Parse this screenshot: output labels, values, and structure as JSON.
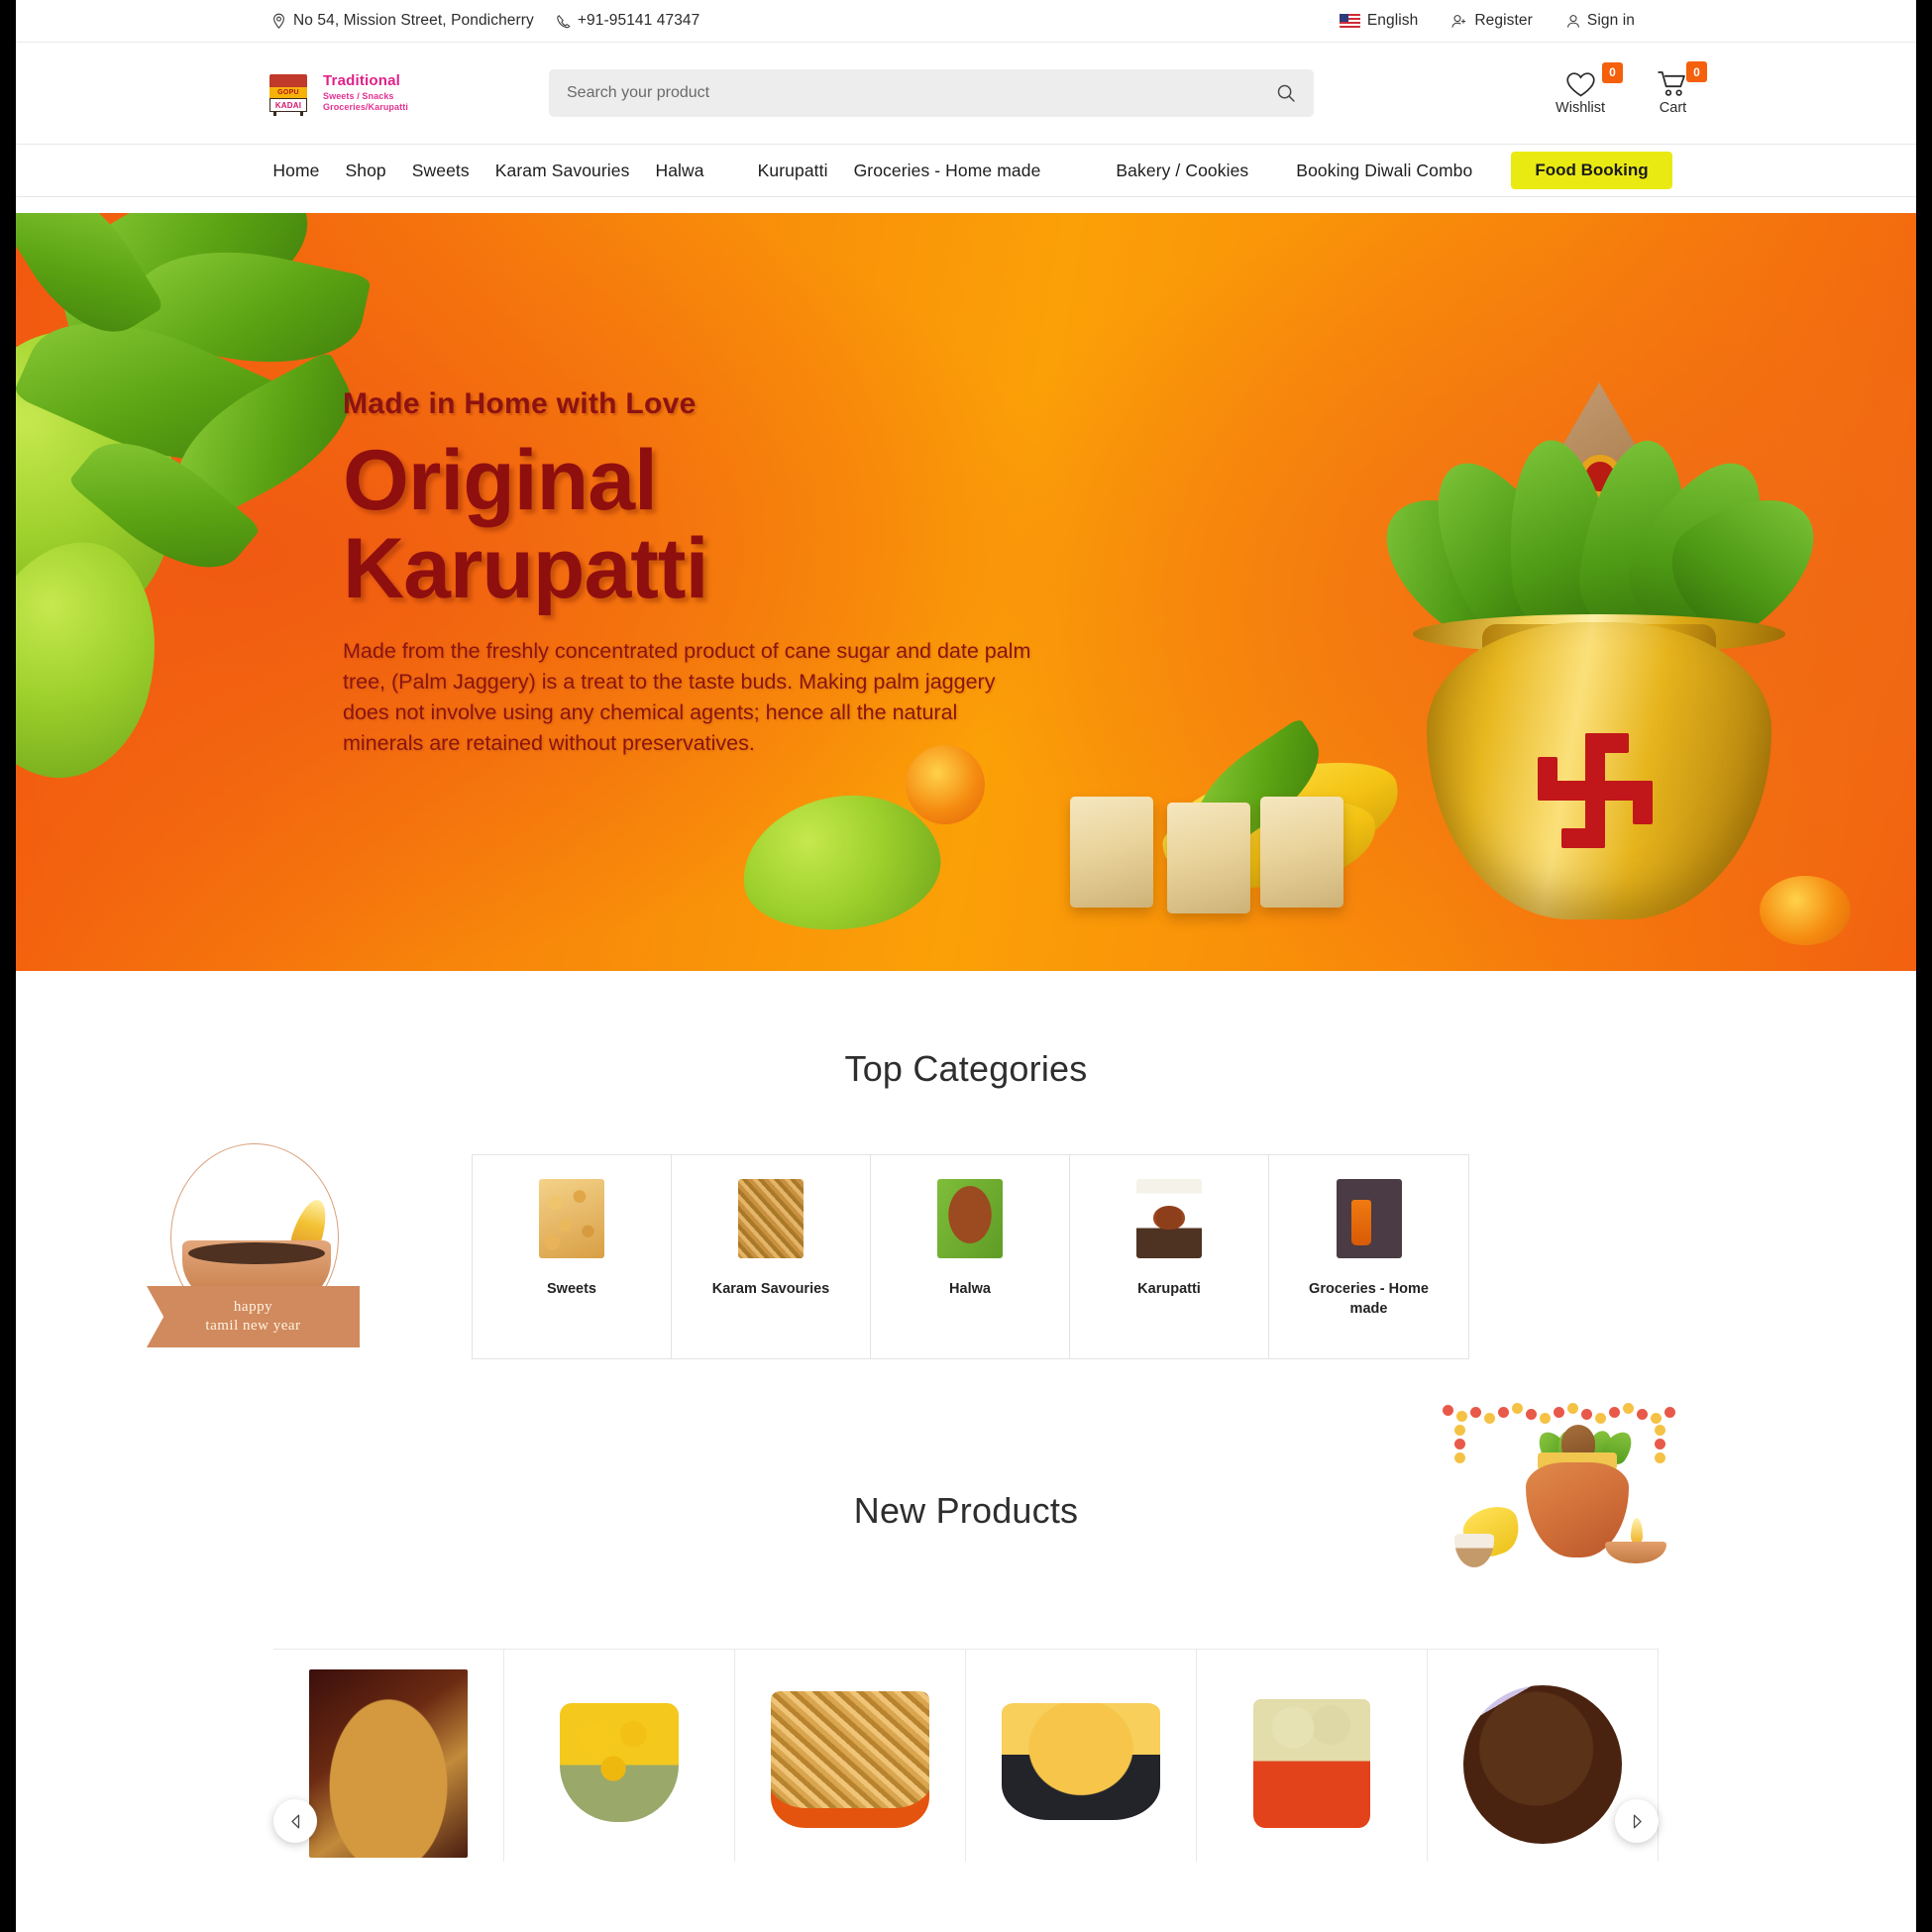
{
  "topbar": {
    "address": "No 54, Mission Street, Pondicherry",
    "phone": "+91-95141 47347",
    "language": "English",
    "register": "Register",
    "signin": "Sign in",
    "icons": {
      "location": "location-pin-icon",
      "phone": "phone-icon",
      "flag": "us-flag-icon",
      "register": "user-add-icon",
      "signin": "user-icon"
    }
  },
  "header": {
    "logo": {
      "shop_sign": "GOPU",
      "shop_name": "KADAI",
      "line1": "Traditional",
      "line2": "Sweets / Snacks",
      "line3": "Groceries/Karupatti"
    },
    "search": {
      "placeholder": "Search your product",
      "value": "",
      "icon": "search-icon"
    },
    "wishlist": {
      "label": "Wishlist",
      "count": "0",
      "icon": "heart-icon"
    },
    "cart": {
      "label": "Cart",
      "count": "0",
      "icon": "shopping-cart-icon"
    },
    "accent_color": "#f4600b"
  },
  "nav": {
    "items": [
      {
        "label": "Home"
      },
      {
        "label": "Shop"
      },
      {
        "label": "Sweets"
      },
      {
        "label": "Karam Savouries"
      },
      {
        "label": "Halwa"
      },
      {
        "label": "Kurupatti"
      },
      {
        "label": "Groceries - Home made"
      },
      {
        "label": "Bakery / Cookies"
      },
      {
        "label": "Booking Diwali Combo"
      }
    ],
    "cta": {
      "label": "Food Booking",
      "bg": "#eaea13"
    }
  },
  "hero": {
    "kicker": "Made in Home with Love",
    "title": "Original Karupatti",
    "body": "Made from the freshly concentrated product of cane sugar and date palm tree,  (Palm Jaggery) is a treat to the taste buds. Making palm jaggery does not involve using any chemical agents; hence all the natural minerals are retained without preservatives.",
    "text_color": "#8f0f0f",
    "bg_color": "#f7820b"
  },
  "categories": {
    "title": "Top Categories",
    "decoration": {
      "line1": "happy",
      "line2": "tamil new year"
    },
    "items": [
      {
        "label": "Sweets",
        "img": "sweets-thumbnail"
      },
      {
        "label": "Karam Savouries",
        "img": "karam-savouries-thumbnail"
      },
      {
        "label": "Halwa",
        "img": "halwa-thumbnail"
      },
      {
        "label": "Karupatti",
        "img": "karupatti-thumbnail"
      },
      {
        "label": "Groceries - Home made",
        "img": "groceries-thumbnail"
      }
    ]
  },
  "new_products": {
    "title": "New Products",
    "items": [
      {
        "img": "jaggery-powder-image"
      },
      {
        "img": "murukku-rings-image"
      },
      {
        "img": "sev-mixture-image"
      },
      {
        "img": "banana-chips-image"
      },
      {
        "img": "kozhukattai-bucket-image"
      },
      {
        "img": "halwa-ball-image"
      }
    ],
    "prev_icon": "chevron-left-icon",
    "next_icon": "chevron-right-icon"
  }
}
